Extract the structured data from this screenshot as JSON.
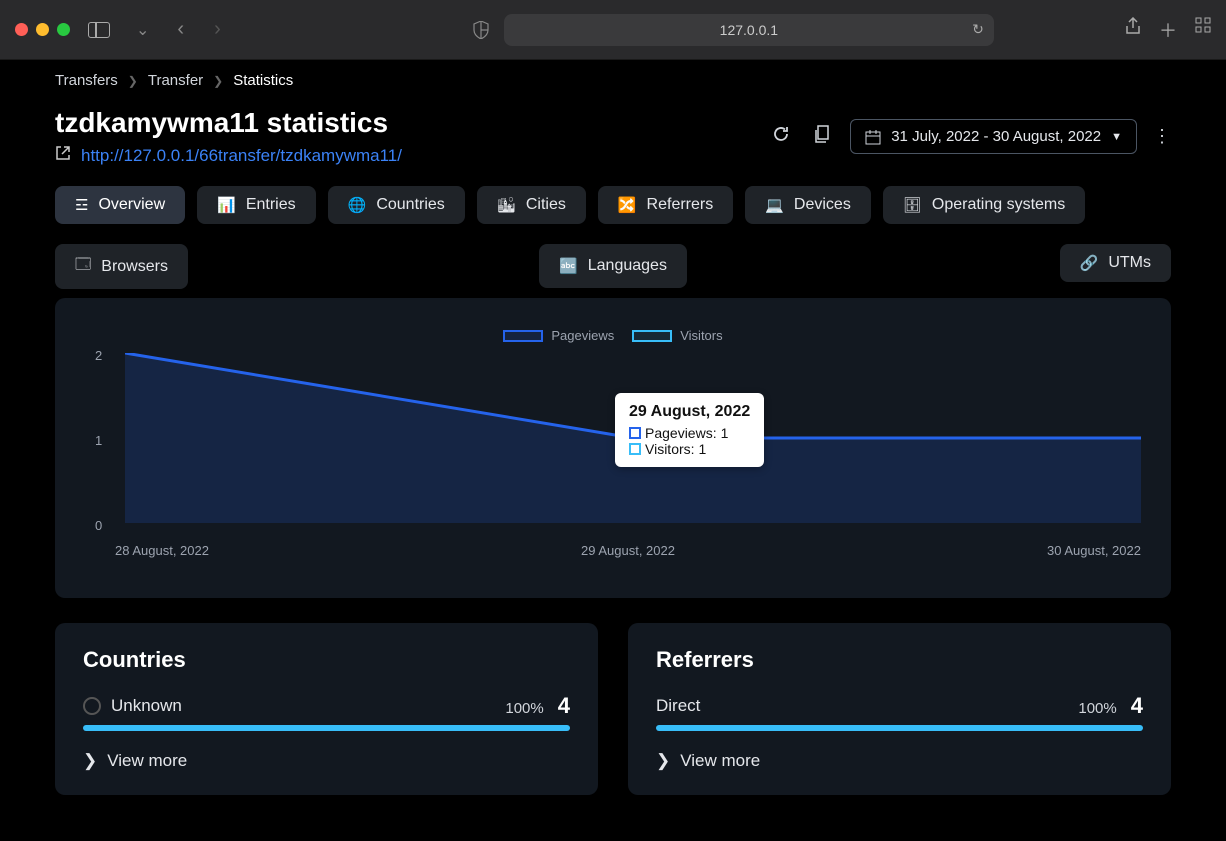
{
  "browser": {
    "address": "127.0.0.1"
  },
  "breadcrumb": {
    "items": [
      "Transfers",
      "Transfer",
      "Statistics"
    ]
  },
  "header": {
    "title": "tzdkamywma11 statistics",
    "url": "http://127.0.0.1/66transfer/tzdkamywma11/",
    "date_range": "31 July, 2022 - 30 August, 2022"
  },
  "tabs": {
    "overview": "Overview",
    "entries": "Entries",
    "countries": "Countries",
    "cities": "Cities",
    "referrers": "Referrers",
    "devices": "Devices",
    "os": "Operating systems",
    "browsers": "Browsers",
    "languages": "Languages",
    "utms": "UTMs"
  },
  "chart_data": {
    "type": "line",
    "title": "",
    "xlabel": "",
    "ylabel": "",
    "ylim": [
      0,
      2
    ],
    "categories": [
      "28 August, 2022",
      "29 August, 2022",
      "30 August, 2022"
    ],
    "series": [
      {
        "name": "Pageviews",
        "values": [
          2,
          1,
          1
        ],
        "color": "#2563eb"
      },
      {
        "name": "Visitors",
        "values": [
          2,
          1,
          1
        ],
        "color": "#38bdf8"
      }
    ],
    "y_ticks": [
      "2",
      "1",
      "0"
    ]
  },
  "tooltip": {
    "title": "29 August, 2022",
    "pageviews_label": "Pageviews:",
    "pageviews_value": "1",
    "visitors_label": "Visitors:",
    "visitors_value": "1"
  },
  "panels": {
    "countries": {
      "title": "Countries",
      "item_label": "Unknown",
      "item_pct": "100%",
      "item_val": "4",
      "view_more": "View more"
    },
    "referrers": {
      "title": "Referrers",
      "item_label": "Direct",
      "item_pct": "100%",
      "item_val": "4",
      "view_more": "View more"
    }
  }
}
